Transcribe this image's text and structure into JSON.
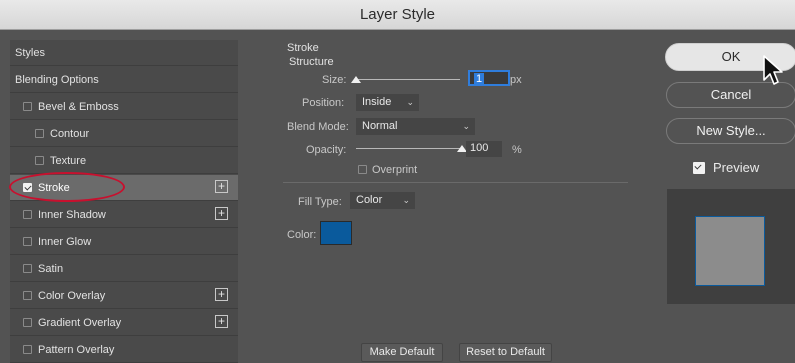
{
  "window": {
    "title": "Layer Style"
  },
  "sidebar": {
    "items": [
      {
        "label": "Styles"
      },
      {
        "label": "Blending Options"
      },
      {
        "label": "Bevel & Emboss",
        "checked": false
      },
      {
        "label": "Contour",
        "checked": false
      },
      {
        "label": "Texture",
        "checked": false
      },
      {
        "label": "Stroke",
        "checked": true
      },
      {
        "label": "Inner Shadow",
        "checked": false
      },
      {
        "label": "Inner Glow",
        "checked": false
      },
      {
        "label": "Satin",
        "checked": false
      },
      {
        "label": "Color Overlay",
        "checked": false
      },
      {
        "label": "Gradient Overlay",
        "checked": false
      },
      {
        "label": "Pattern Overlay",
        "checked": false
      }
    ],
    "plus_symbol": "+"
  },
  "stroke": {
    "heading": "Stroke",
    "subheading": "Structure",
    "size_label": "Size:",
    "size_value": "1",
    "size_unit": "px",
    "position_label": "Position:",
    "position_value": "Inside",
    "blend_label": "Blend Mode:",
    "blend_value": "Normal",
    "opacity_label": "Opacity:",
    "opacity_value": "100",
    "opacity_unit": "%",
    "opacity_fraction": 1.0,
    "size_fraction": 0.0,
    "overprint_label": "Overprint",
    "overprint_checked": false,
    "fill_type_label": "Fill Type:",
    "fill_type_value": "Color",
    "color_label": "Color:",
    "color_swatch": "#0a5a9c"
  },
  "footer": {
    "make_default": "Make Default",
    "reset_default": "Reset to Default"
  },
  "actions": {
    "ok": "OK",
    "cancel": "Cancel",
    "new_style": "New Style...",
    "preview_label": "Preview",
    "preview_checked": true
  },
  "colors": {
    "accent_highlight": "#c8102e",
    "focus_blue": "#2f7ddc",
    "stroke_color": "#0a5a9c"
  }
}
